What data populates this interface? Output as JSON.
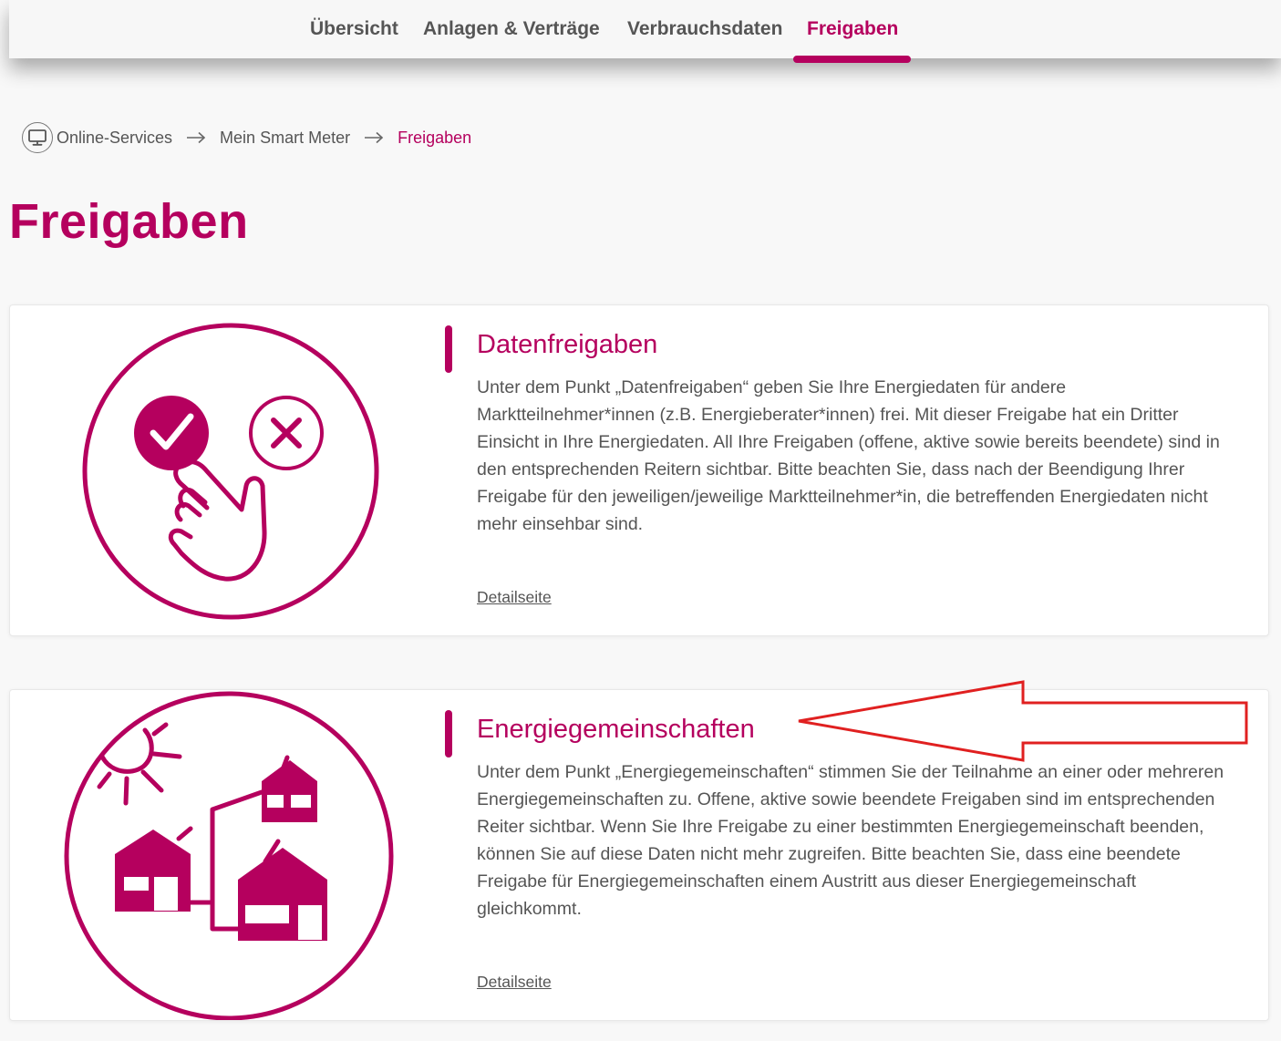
{
  "nav": {
    "tabs": [
      {
        "label": "Übersicht"
      },
      {
        "label": "Anlagen & Verträge"
      },
      {
        "label": "Verbrauchsdaten"
      },
      {
        "label": "Freigaben",
        "active": true
      }
    ]
  },
  "breadcrumb": {
    "home_icon": "monitor-icon",
    "items": [
      "Online-Services",
      "Mein Smart Meter",
      "Freigaben"
    ]
  },
  "page": {
    "title": "Freigaben"
  },
  "cards": [
    {
      "title": "Datenfreigaben",
      "text": "Unter dem Punkt „Datenfreigaben“ geben Sie Ihre Energiedaten für andere Marktteilnehmer*innen (z.B. Energieberater*innen) frei. Mit dieser Freigabe hat ein Dritter Einsicht in Ihre Energiedaten. All Ihre Freigaben (offene, aktive sowie bereits beendete) sind in den entsprechenden Reitern sichtbar. Bitte beachten Sie, dass nach der Beendigung Ihrer Freigabe für den jeweiligen/jeweilige Marktteilnehmer*in, die betreffenden Energiedaten nicht mehr einsehbar sind.",
      "link": "Detailseite",
      "icon": "consent-hand-icon"
    },
    {
      "title": "Energiegemeinschaften",
      "text": "Unter dem Punkt „Energiegemeinschaften“ stimmen Sie der Teilnahme an einer oder mehreren Energiegemeinschaften zu. Offene, aktive sowie beendete Freigaben sind im entsprechenden Reiter sichtbar. Wenn Sie Ihre Freigabe zu einer bestimmten Energiegemeinschaft beenden, können Sie auf diese Daten nicht mehr zugreifen. Bitte beachten Sie, dass eine beendete Freigabe für Energiegemeinschaften einem Austritt aus dieser Energiegemeinschaft gleichkommt.",
      "link": "Detailseite",
      "icon": "energy-community-icon"
    }
  ],
  "colors": {
    "brand": "#b5005e",
    "annotation": "#e02020"
  }
}
